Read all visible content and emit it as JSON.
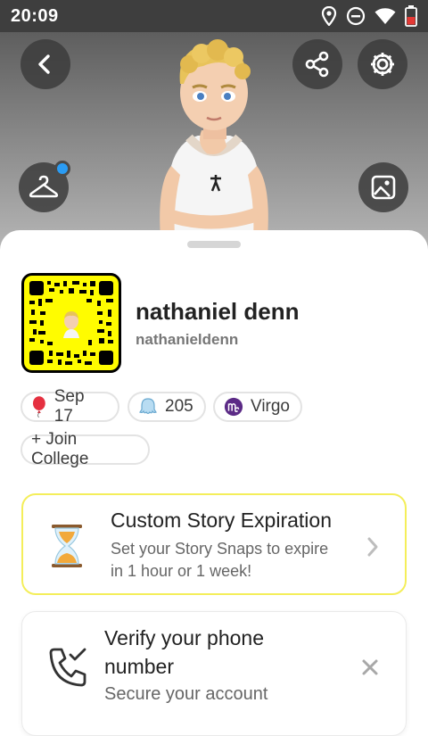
{
  "status_bar": {
    "time": "20:09"
  },
  "profile": {
    "display_name": "nathaniel denn",
    "username": "nathanieldenn"
  },
  "chips": {
    "birthday": "Sep 17",
    "score": "205",
    "zodiac": "Virgo",
    "join_college": "+ Join College"
  },
  "cards": {
    "story_expiration": {
      "title": "Custom Story Expiration",
      "line1": "Set your Story Snaps to expire",
      "line2": "in 1 hour or 1 week!"
    },
    "verify_phone": {
      "title_line1": "Verify your phone",
      "title_line2": "number",
      "subtitle": "Secure your account"
    }
  },
  "colors": {
    "snap_yellow": "#fffc00",
    "accent_blue": "#2a9cf4",
    "zodiac_purple": "#5b2a86"
  },
  "icons": [
    "back-icon",
    "share-icon",
    "gear-icon",
    "hanger-icon",
    "image-icon",
    "balloon-icon",
    "ghost-icon",
    "virgo-icon",
    "hourglass-icon",
    "phone-check-icon",
    "close-icon",
    "chevron-right-icon"
  ]
}
